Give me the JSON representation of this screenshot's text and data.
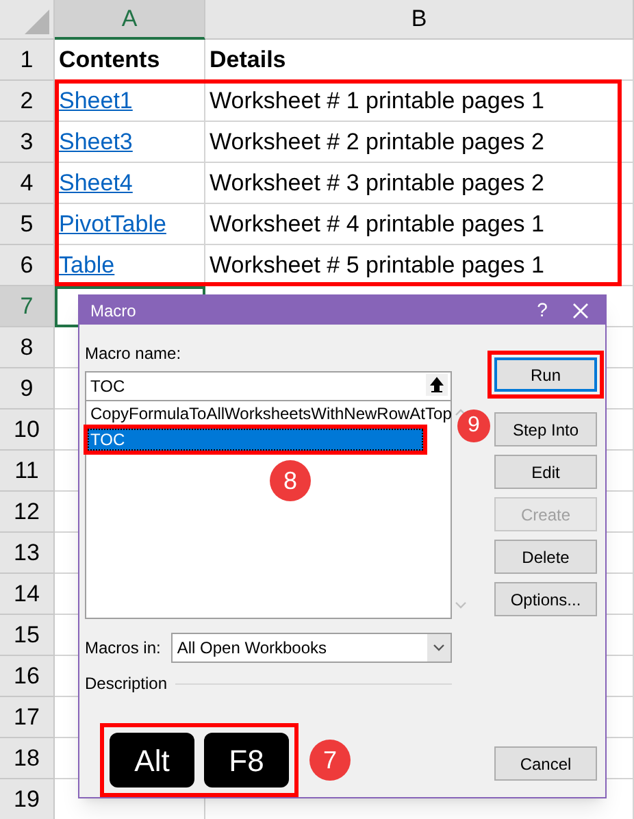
{
  "columns": [
    {
      "label": "A",
      "selected": true
    },
    {
      "label": "B",
      "selected": false
    }
  ],
  "rows": [
    {
      "number": "1",
      "selected": false,
      "cells": [
        {
          "kind": "header",
          "text": "Contents"
        },
        {
          "kind": "header",
          "text": "Details"
        }
      ]
    },
    {
      "number": "2",
      "selected": false,
      "cells": [
        {
          "kind": "link",
          "text": "Sheet1"
        },
        {
          "kind": "text",
          "text": "Worksheet # 1 printable pages 1"
        }
      ]
    },
    {
      "number": "3",
      "selected": false,
      "cells": [
        {
          "kind": "link",
          "text": "Sheet3"
        },
        {
          "kind": "text",
          "text": "Worksheet # 2 printable pages 2"
        }
      ]
    },
    {
      "number": "4",
      "selected": false,
      "cells": [
        {
          "kind": "link",
          "text": "Sheet4"
        },
        {
          "kind": "text",
          "text": "Worksheet # 3 printable pages 2"
        }
      ]
    },
    {
      "number": "5",
      "selected": false,
      "cells": [
        {
          "kind": "link",
          "text": "PivotTable"
        },
        {
          "kind": "text",
          "text": "Worksheet # 4 printable pages 1"
        }
      ]
    },
    {
      "number": "6",
      "selected": false,
      "cells": [
        {
          "kind": "link",
          "text": "Table"
        },
        {
          "kind": "text",
          "text": "Worksheet # 5 printable pages 1"
        }
      ]
    },
    {
      "number": "7",
      "selected": true
    },
    {
      "number": "8",
      "selected": false
    },
    {
      "number": "9",
      "selected": false
    },
    {
      "number": "10",
      "selected": false
    },
    {
      "number": "11",
      "selected": false
    },
    {
      "number": "12",
      "selected": false
    },
    {
      "number": "13",
      "selected": false
    },
    {
      "number": "14",
      "selected": false
    },
    {
      "number": "15",
      "selected": false
    },
    {
      "number": "16",
      "selected": false
    },
    {
      "number": "17",
      "selected": false
    },
    {
      "number": "18",
      "selected": false
    },
    {
      "number": "19",
      "selected": false
    }
  ],
  "dialog": {
    "title": "Macro",
    "help": "?",
    "macro_name_label": "Macro name:",
    "macro_name": "TOC",
    "macros": [
      {
        "text": "CopyFormulaToAllWorksheetsWithNewRowAtTop",
        "selected": false
      },
      {
        "text": "TOC",
        "selected": true
      }
    ],
    "buttons": [
      {
        "label": "Run",
        "default": true,
        "disabled": false
      },
      {
        "label": "Step Into",
        "default": false,
        "disabled": false
      },
      {
        "label": "Edit",
        "default": false,
        "disabled": false
      },
      {
        "label": "Create",
        "default": false,
        "disabled": true
      },
      {
        "label": "Delete",
        "default": false,
        "disabled": false
      },
      {
        "label": "Options...",
        "default": false,
        "disabled": false
      }
    ],
    "cancel": "Cancel",
    "macros_in_label": "Macros in:",
    "macros_in": "All Open Workbooks",
    "description_label": "Description"
  },
  "keys": [
    "Alt",
    "F8"
  ],
  "steps": [
    "7",
    "8",
    "9"
  ]
}
